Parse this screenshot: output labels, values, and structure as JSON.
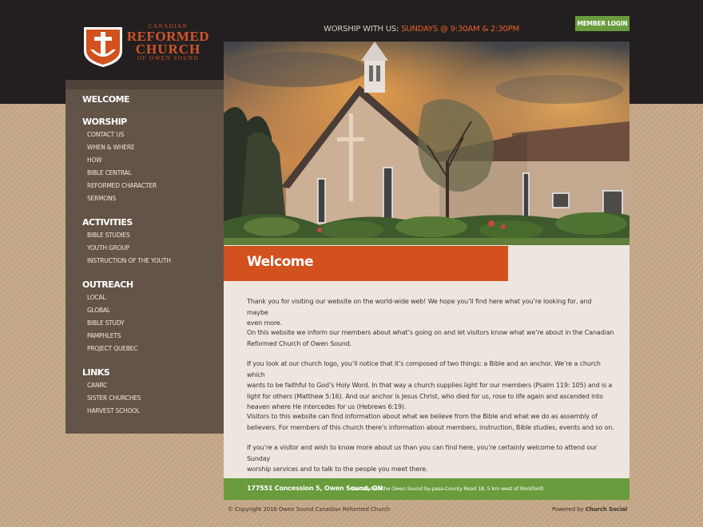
{
  "header": {
    "logo": {
      "line1": "CANADIAN",
      "line2": "REFORMED",
      "line3": "CHURCH",
      "line4": "OF OWEN SOUND"
    },
    "worship_prefix": "WORSHIP WITH US: ",
    "worship_times": "SUNDAYS @ 9:30AM & 2:30PM",
    "member_login": "MEMBER LOGIN"
  },
  "nav": {
    "welcome": "WELCOME",
    "sections": [
      {
        "title": "WORSHIP",
        "items": [
          "CONTACT US",
          "WHEN & WHERE",
          "HOW",
          "BIBLE CENTRAL",
          "REFORMED CHARACTER",
          "SERMONS"
        ]
      },
      {
        "title": "ACTIVITIES",
        "items": [
          "BIBLE STUDIES",
          "YOUTH GROUP",
          "INSTRUCTION OF THE YOUTH"
        ]
      },
      {
        "title": "OUTREACH",
        "items": [
          "LOCAL",
          "GLOBAL",
          "BIBLE STUDY",
          "PAMPHLETS",
          "PROJECT QUEBEC"
        ]
      },
      {
        "title": "LINKS",
        "items": [
          "CANRC",
          "SISTER CHURCHES",
          "HARVEST SCHOOL"
        ]
      }
    ]
  },
  "main": {
    "title": "Welcome",
    "paragraphs": [
      [
        "Thank you for visiting our website on the world-wide web! We hope you’ll find here what you’re looking for, and maybe",
        "even more."
      ],
      [
        "On this website we inform our members about what’s going on and let visitors know what we’re about in the Canadian",
        "Reformed Church of Owen Sound."
      ],
      [
        "If you look at our church logo, you’ll notice that it’s composed of two things: a Bible and an anchor. We’re a church which",
        "wants to be faithful to God’s Holy Word. In that way a church supplies light for our members (Psalm 119: 105) and is a",
        "light for others (Matthew 5:16). And our anchor is Jesus Christ, who died for us, rose to life again and ascended into",
        "heaven where He intercedes for us (Hebrews 6:19)."
      ],
      [
        "Visitors to this website can find information about what we believe from the Bible and what we do as assembly of",
        "believers. For members of this church there’s information about members, instruction, Bible studies, events and so on."
      ],
      [
        "If you’re a visitor and wish to know more about us than you can find here, you’re certainly welcome to attend our Sunday",
        "worship services and to talk to the people you meet there."
      ]
    ]
  },
  "footer": {
    "address": "177551 Concession 5, Owen Sound, ON",
    "address_note": "(Located on the Owen Sound by-pass-County Road 18, 5 km west of Rockford)",
    "copyright": "© Copyright 2016 Owen Sound Canadian Reformed Church",
    "powered_prefix": "Powered by ",
    "powered_brand": "Church Social"
  },
  "colors": {
    "accent": "#d2511f",
    "green": "#6a9b3d",
    "dark": "#231f20"
  }
}
